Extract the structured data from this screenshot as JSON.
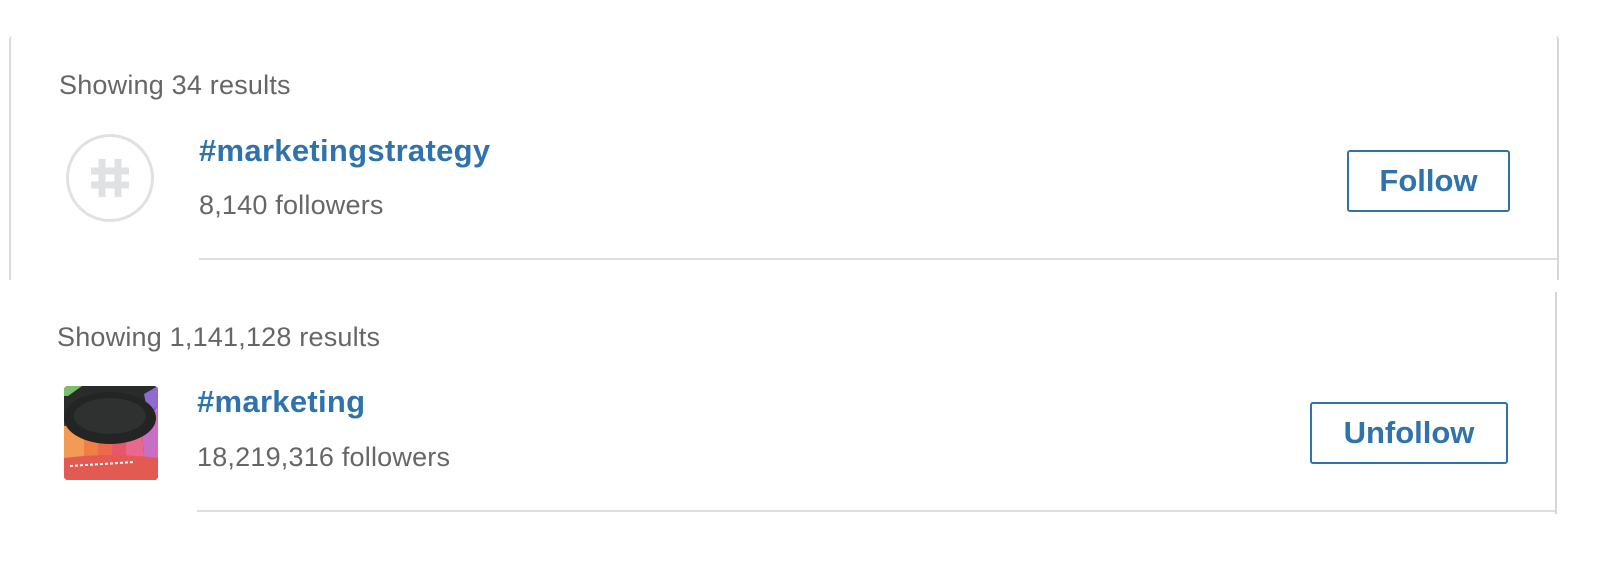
{
  "results": [
    {
      "count_text": "Showing 34 results",
      "hashtag": "#marketingstrategy",
      "followers": "8,140 followers",
      "button_label": "Follow",
      "avatar": "hashtag-icon"
    },
    {
      "count_text": "Showing 1,141,128 results",
      "hashtag": "#marketing",
      "followers": "18,219,316 followers",
      "button_label": "Unfollow",
      "avatar": "hashtag-photo"
    }
  ],
  "colors": {
    "link_blue": "#2f72ac",
    "muted_text": "#666666",
    "divider": "#dedede"
  }
}
